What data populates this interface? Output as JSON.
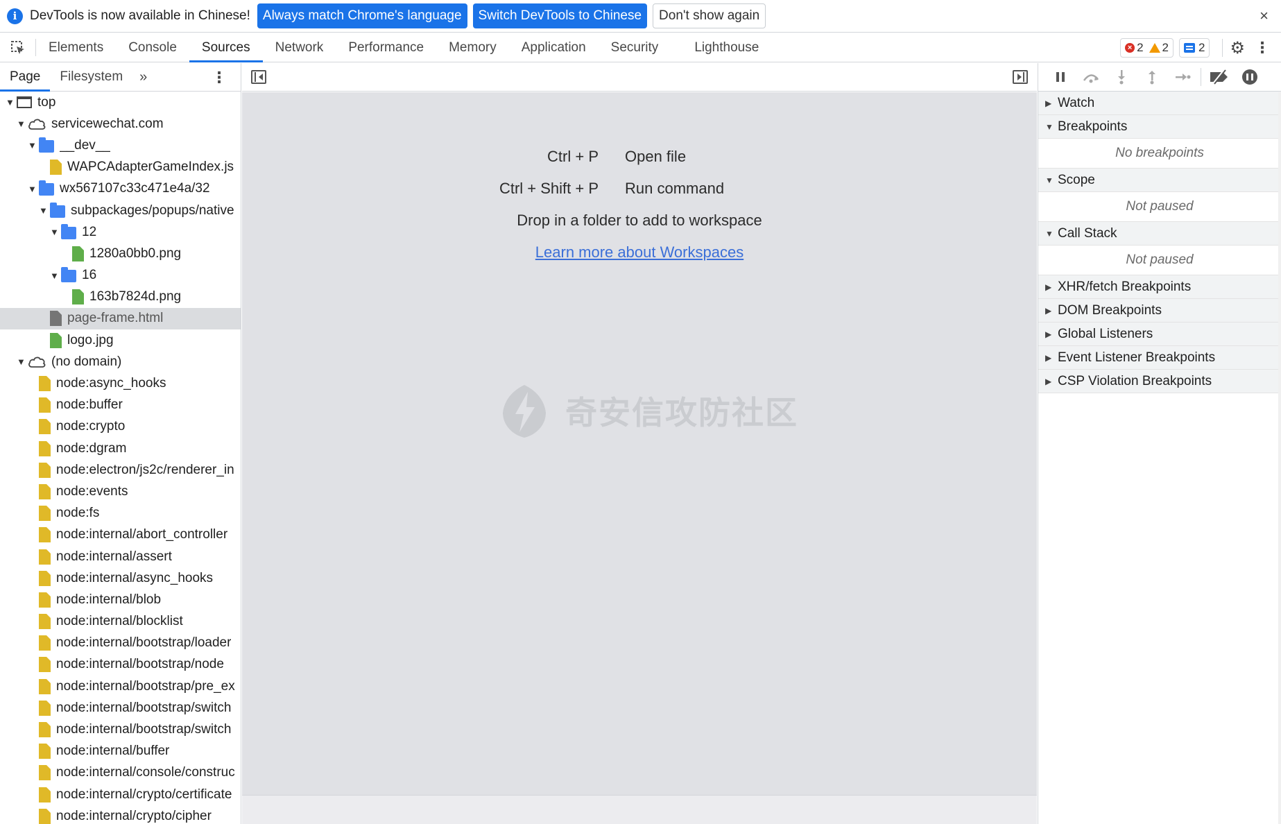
{
  "infobar": {
    "message": "DevTools is now available in Chinese!",
    "btn_match": "Always match Chrome's language",
    "btn_switch": "Switch DevTools to Chinese",
    "btn_dismiss": "Don't show again",
    "close": "×"
  },
  "tabs": [
    "Elements",
    "Console",
    "Sources",
    "Network",
    "Performance",
    "Memory",
    "Application",
    "Security",
    "Lighthouse"
  ],
  "status": {
    "errors": "2",
    "warnings": "2",
    "messages": "2"
  },
  "navigator": {
    "tabs": [
      "Page",
      "Filesystem"
    ],
    "more": "»",
    "tree": [
      {
        "label": "top",
        "level": 0,
        "arrow": "▼",
        "icon": "frame"
      },
      {
        "label": "servicewechat.com",
        "level": 1,
        "arrow": "▼",
        "icon": "cloud"
      },
      {
        "label": "__dev__",
        "level": 2,
        "arrow": "▼",
        "icon": "folder"
      },
      {
        "label": "WAPCAdapterGameIndex.js",
        "level": 3,
        "arrow": "",
        "icon": "js"
      },
      {
        "label": "wx567107c33c471e4a/32",
        "level": 2,
        "arrow": "▼",
        "icon": "folder"
      },
      {
        "label": "subpackages/popups/native",
        "level": 3,
        "arrow": "▼",
        "icon": "folder"
      },
      {
        "label": "12",
        "level": 4,
        "arrow": "▼",
        "icon": "folder"
      },
      {
        "label": "1280a0bb0.png",
        "level": 5,
        "arrow": "",
        "icon": "img"
      },
      {
        "label": "16",
        "level": 4,
        "arrow": "▼",
        "icon": "folder"
      },
      {
        "label": "163b7824d.png",
        "level": 5,
        "arrow": "",
        "icon": "img"
      },
      {
        "label": "page-frame.html",
        "level": 3,
        "arrow": "",
        "icon": "doc",
        "selected": true
      },
      {
        "label": "logo.jpg",
        "level": 3,
        "arrow": "",
        "icon": "img"
      },
      {
        "label": "(no domain)",
        "level": 1,
        "arrow": "▼",
        "icon": "cloud"
      },
      {
        "label": "node:async_hooks",
        "level": 2,
        "arrow": "",
        "icon": "js"
      },
      {
        "label": "node:buffer",
        "level": 2,
        "arrow": "",
        "icon": "js"
      },
      {
        "label": "node:crypto",
        "level": 2,
        "arrow": "",
        "icon": "js"
      },
      {
        "label": "node:dgram",
        "level": 2,
        "arrow": "",
        "icon": "js"
      },
      {
        "label": "node:electron/js2c/renderer_in",
        "level": 2,
        "arrow": "",
        "icon": "js"
      },
      {
        "label": "node:events",
        "level": 2,
        "arrow": "",
        "icon": "js"
      },
      {
        "label": "node:fs",
        "level": 2,
        "arrow": "",
        "icon": "js"
      },
      {
        "label": "node:internal/abort_controller",
        "level": 2,
        "arrow": "",
        "icon": "js"
      },
      {
        "label": "node:internal/assert",
        "level": 2,
        "arrow": "",
        "icon": "js"
      },
      {
        "label": "node:internal/async_hooks",
        "level": 2,
        "arrow": "",
        "icon": "js"
      },
      {
        "label": "node:internal/blob",
        "level": 2,
        "arrow": "",
        "icon": "js"
      },
      {
        "label": "node:internal/blocklist",
        "level": 2,
        "arrow": "",
        "icon": "js"
      },
      {
        "label": "node:internal/bootstrap/loader",
        "level": 2,
        "arrow": "",
        "icon": "js"
      },
      {
        "label": "node:internal/bootstrap/node",
        "level": 2,
        "arrow": "",
        "icon": "js"
      },
      {
        "label": "node:internal/bootstrap/pre_ex",
        "level": 2,
        "arrow": "",
        "icon": "js"
      },
      {
        "label": "node:internal/bootstrap/switch",
        "level": 2,
        "arrow": "",
        "icon": "js"
      },
      {
        "label": "node:internal/bootstrap/switch",
        "level": 2,
        "arrow": "",
        "icon": "js"
      },
      {
        "label": "node:internal/buffer",
        "level": 2,
        "arrow": "",
        "icon": "js"
      },
      {
        "label": "node:internal/console/construc",
        "level": 2,
        "arrow": "",
        "icon": "js"
      },
      {
        "label": "node:internal/crypto/certificate",
        "level": 2,
        "arrow": "",
        "icon": "js"
      },
      {
        "label": "node:internal/crypto/cipher",
        "level": 2,
        "arrow": "",
        "icon": "js"
      }
    ]
  },
  "editor": {
    "open_file_key": "Ctrl + P",
    "open_file_label": "Open file",
    "run_cmd_key": "Ctrl + Shift + P",
    "run_cmd_label": "Run command",
    "drop_hint": "Drop in a folder to add to workspace",
    "learn_more": "Learn more about Workspaces",
    "watermark": "奇安信攻防社区"
  },
  "debugger": {
    "watch": "Watch",
    "breakpoints": "Breakpoints",
    "no_breakpoints": "No breakpoints",
    "scope": "Scope",
    "not_paused_scope": "Not paused",
    "call_stack": "Call Stack",
    "not_paused_stack": "Not paused",
    "xhr": "XHR/fetch Breakpoints",
    "dom": "DOM Breakpoints",
    "global": "Global Listeners",
    "event": "Event Listener Breakpoints",
    "csp": "CSP Violation Breakpoints"
  },
  "colors": {
    "accent": "#1a73e8",
    "editor_bg": "#e0e1e5",
    "link": "#3b6fd8"
  }
}
